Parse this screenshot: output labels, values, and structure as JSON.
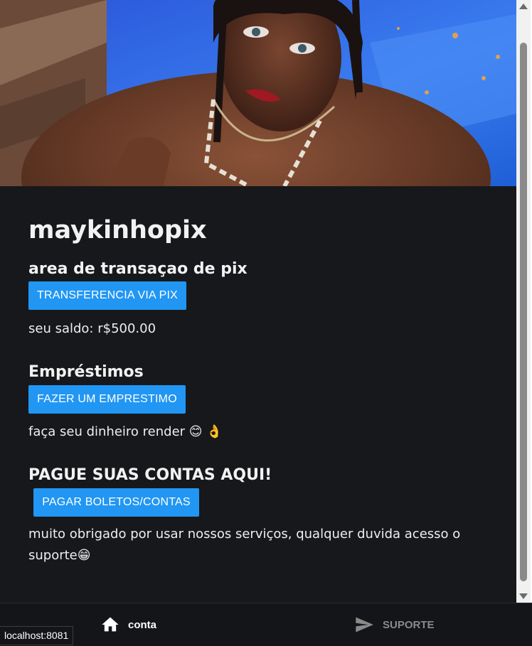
{
  "profile": {
    "username": "maykinhopix"
  },
  "pix": {
    "heading": "area de transaçao de pix",
    "button_label": "TRANSFERENCIA VIA PIX",
    "balance_text": "seu saldo: r$500.00"
  },
  "loans": {
    "heading": "Empréstimos",
    "button_label": "FAZER UM EMPRESTIMO",
    "tagline": "faça seu dinheiro render 😊 👌"
  },
  "bills": {
    "heading": "PAGUE SUAS CONTAS AQUI!",
    "button_label": "PAGAR BOLETOS/CONTAS",
    "thanks_text": "muito obrigado por usar nossos serviços, qualquer duvida acesso o suporte😁"
  },
  "bottom_nav": {
    "items": [
      {
        "label": "conta",
        "icon": "home-icon",
        "active": true
      },
      {
        "label": "SUPORTE",
        "icon": "send-icon",
        "active": false
      }
    ]
  },
  "status_bar": {
    "url": "localhost:8081"
  },
  "colors": {
    "background": "#16181b",
    "primary_button": "#2196f3",
    "text": "#f2f2f2",
    "nav_active": "#ffffff",
    "nav_inactive": "#8a8a8a"
  }
}
